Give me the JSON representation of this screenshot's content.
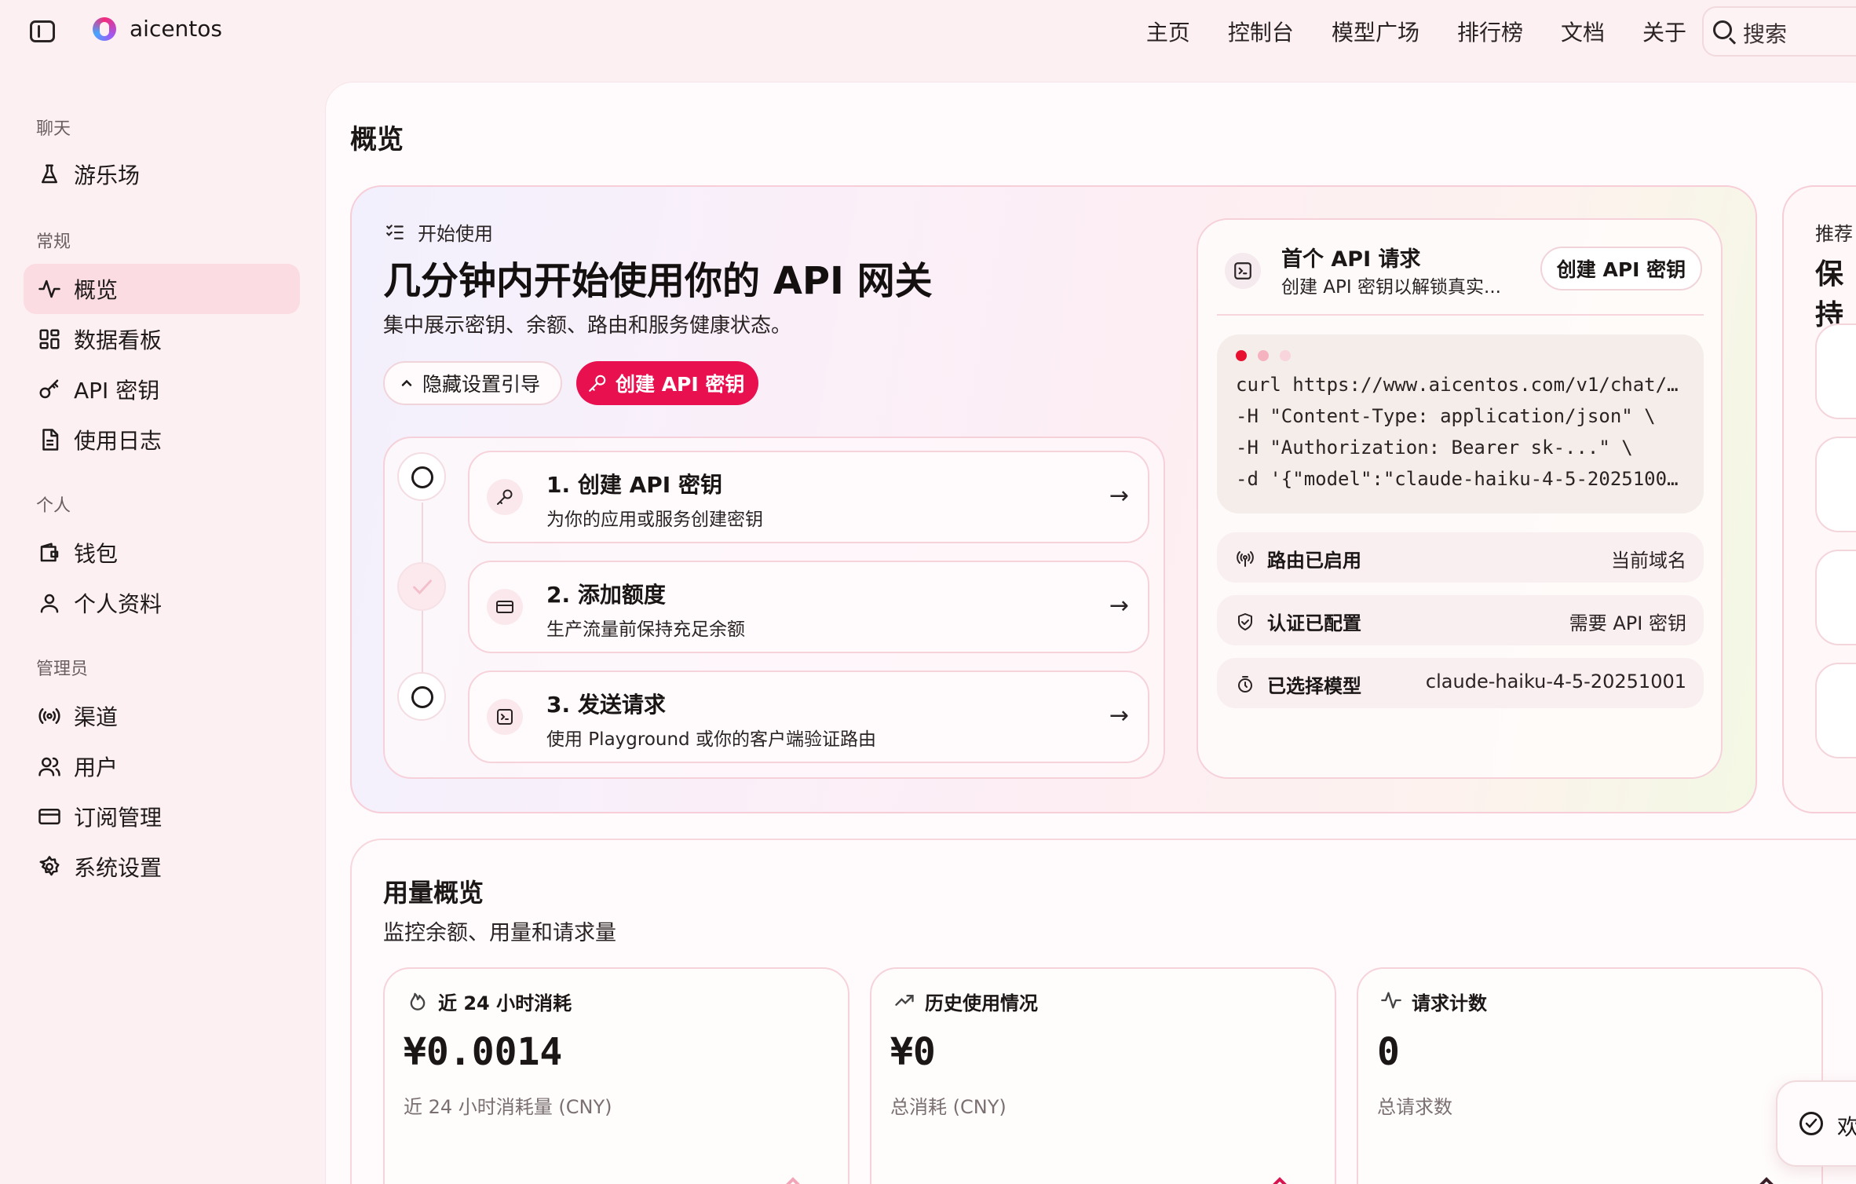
{
  "brand": {
    "name": "aicentos"
  },
  "topnav": [
    "主页",
    "控制台",
    "模型广场",
    "排行榜",
    "文档",
    "关于"
  ],
  "search": {
    "label": "搜索"
  },
  "sidebar": {
    "sections": [
      {
        "heading": "聊天",
        "items": [
          {
            "label": "游乐场",
            "icon": "flask-icon"
          }
        ]
      },
      {
        "heading": "常规",
        "items": [
          {
            "label": "概览",
            "icon": "activity-icon",
            "active": true
          },
          {
            "label": "数据看板",
            "icon": "grid-icon"
          },
          {
            "label": "API 密钥",
            "icon": "key-icon"
          },
          {
            "label": "使用日志",
            "icon": "document-icon"
          }
        ]
      },
      {
        "heading": "个人",
        "items": [
          {
            "label": "钱包",
            "icon": "wallet-icon"
          },
          {
            "label": "个人资料",
            "icon": "user-icon"
          }
        ]
      },
      {
        "heading": "管理员",
        "items": [
          {
            "label": "渠道",
            "icon": "broadcast-icon"
          },
          {
            "label": "用户",
            "icon": "users-icon"
          },
          {
            "label": "订阅管理",
            "icon": "card-icon"
          },
          {
            "label": "系统设置",
            "icon": "gear-icon"
          }
        ]
      }
    ]
  },
  "page": {
    "title": "概览"
  },
  "hero": {
    "eyebrow": "开始使用",
    "title": "几分钟内开始使用你的 API 网关",
    "subtitle": "集中展示密钥、余额、路由和服务健康状态。",
    "hide_button": "隐藏设置引导",
    "create_button": "创建 API 密钥",
    "steps": [
      {
        "title": "1. 创建 API 密钥",
        "desc": "为你的应用或服务创建密钥",
        "status": "pending"
      },
      {
        "title": "2. 添加额度",
        "desc": "生产流量前保持充足余额",
        "status": "done"
      },
      {
        "title": "3. 发送请求",
        "desc": "使用 Playground 或你的客户端验证路由",
        "status": "pending"
      }
    ]
  },
  "api_card": {
    "title": "首个 API 请求",
    "subtitle": "创建 API 密钥以解锁真实...",
    "button": "创建 API 密钥",
    "code": [
      "curl https://www.aicentos.com/v1/chat/…",
      "-H \"Content-Type: application/json\" \\",
      "-H \"Authorization: Bearer sk-...\" \\",
      "-d '{\"model\":\"claude-haiku-4-5-2025100…"
    ],
    "rows": [
      {
        "label": "路由已启用",
        "value": "当前域名"
      },
      {
        "label": "认证已配置",
        "value": "需要 API 密钥"
      },
      {
        "label": "已选择模型",
        "value": "claude-haiku-4-5-20251001"
      }
    ]
  },
  "recommend": {
    "label": "推荐",
    "title": "保持"
  },
  "usage": {
    "title": "用量概览",
    "subtitle": "监控余额、用量和请求量",
    "cards": [
      {
        "label": "近 24 小时消耗",
        "value": "¥0.0014",
        "desc": "近 24 小时消耗量 (CNY)"
      },
      {
        "label": "历史使用情况",
        "value": "¥0",
        "desc": "总消耗 (CNY)"
      },
      {
        "label": "请求计数",
        "value": "0",
        "desc": "总请求数"
      }
    ]
  },
  "toast": {
    "text": "欢"
  },
  "colors": {
    "accent": "#e8104f",
    "active_bg": "#fbdce2",
    "page_bg": "#fdf0f2"
  }
}
